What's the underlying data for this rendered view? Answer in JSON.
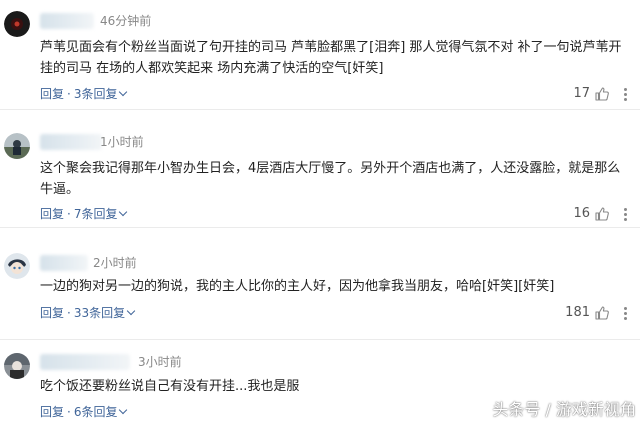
{
  "comments": [
    {
      "time": "46分钟前",
      "text": "芦苇见面会有个粉丝当面说了句开挂的司马 芦苇脸都黑了[泪奔] 那人觉得气氛不对 补了一句说芦苇开挂的司马 在场的人都欢笑起来 场内充满了快活的空气[奸笑]",
      "reply_label": "回复",
      "replies_label": "3条回复",
      "likes": "17"
    },
    {
      "time": "1小时前",
      "text": "这个聚会我记得那年小智办生日会，4层酒店大厅慢了。另外开个酒店也满了，人还没露脸，就是那么牛逼。",
      "reply_label": "回复",
      "replies_label": "7条回复",
      "likes": "16"
    },
    {
      "time": "2小时前",
      "text": "一边的狗对另一边的狗说，我的主人比你的主人好，因为他拿我当朋友，哈哈[奸笑][奸笑]",
      "reply_label": "回复",
      "replies_label": "33条回复",
      "likes": "181"
    },
    {
      "time": "3小时前",
      "text": "吃个饭还要粉丝说自己有没有开挂...我也是服",
      "reply_label": "回复",
      "replies_label": "6条回复",
      "likes": ""
    }
  ],
  "separator": "·",
  "watermark": "头条号 / 游戏新视角",
  "icons": {
    "like": "thumbs-up-icon",
    "more": "more-vertical-icon",
    "expand": "chevron-down-icon"
  },
  "colors": {
    "link": "#406599",
    "meta": "#888888",
    "text": "#222222"
  }
}
